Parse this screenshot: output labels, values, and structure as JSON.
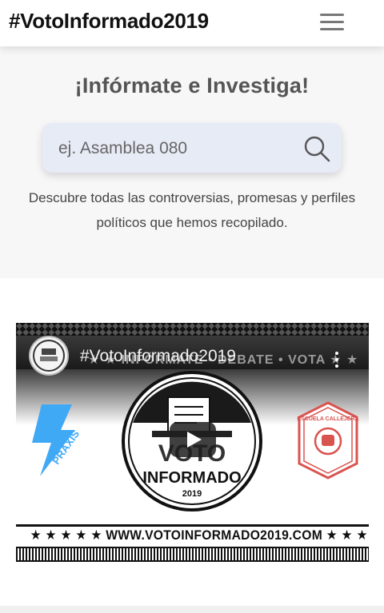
{
  "header": {
    "brand": "#VotoInformado2019",
    "menu_icon": "hamburger-icon"
  },
  "hero": {
    "title": "¡Infórmate e Investiga!",
    "search": {
      "placeholder": "ej. Asamblea 080",
      "value": "",
      "icon": "search-icon"
    },
    "description": "Descubre todas las controversias, promesas y perfiles políticos que hemos recopilado."
  },
  "video": {
    "title": "#VotoInformado2019",
    "banner_text": "★ ★ INFÓRMATE • DEBATE • VOTA ★ ★",
    "main_logo": {
      "line1": "VOTO",
      "line2": "INFORMADO",
      "year": "2019"
    },
    "left_logo_text": "PRAXIS",
    "right_logo_text": "ESCUELA CALLEJERA",
    "url_banner": "★ ★ ★ ★ ★ WWW.VOTOINFORMADO2019.COM ★ ★ ★ ★ ★",
    "play_icon": "play-icon",
    "kebab_icon": "more-vertical-icon"
  },
  "colors": {
    "search_bg": "#e7ebf6",
    "praxis_blue": "#3fa9f5",
    "escuela_red": "#d9534f"
  }
}
